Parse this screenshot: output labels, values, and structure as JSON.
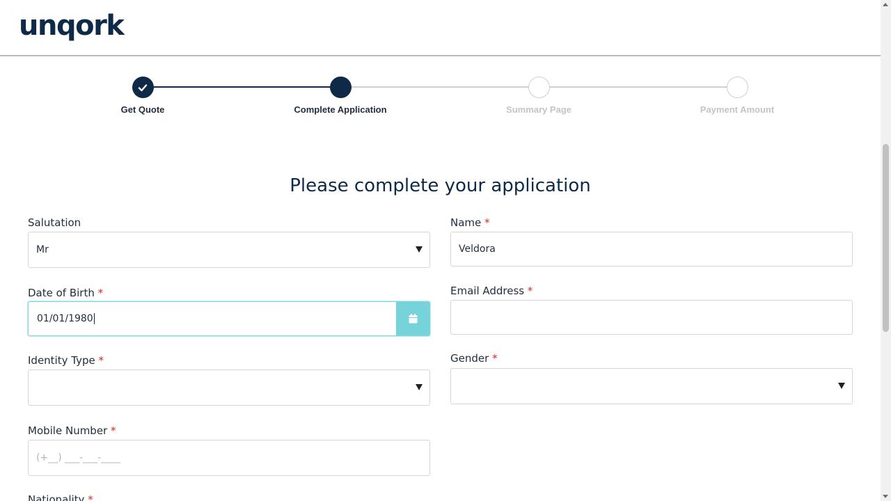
{
  "header": {
    "logo": "unqork"
  },
  "stepper": {
    "steps": [
      {
        "label": "Get Quote",
        "state": "done"
      },
      {
        "label": "Complete Application",
        "state": "active"
      },
      {
        "label": "Summary Page",
        "state": "todo"
      },
      {
        "label": "Payment Amount",
        "state": "todo"
      }
    ]
  },
  "form": {
    "title": "Please complete your application",
    "salutation": {
      "label": "Salutation",
      "value": "Mr"
    },
    "name": {
      "label": "Name",
      "required": "*",
      "value": "Veldora"
    },
    "dob": {
      "label": "Date of Birth",
      "required": "*",
      "value": "01/01/1980"
    },
    "email": {
      "label": "Email Address",
      "required": "*",
      "value": ""
    },
    "identity_type": {
      "label": "Identity Type",
      "required": "*",
      "value": ""
    },
    "gender": {
      "label": "Gender",
      "required": "*",
      "value": ""
    },
    "mobile": {
      "label": "Mobile Number",
      "required": "*",
      "placeholder": "(+__) ___-___-____"
    },
    "nationality": {
      "label": "Nationality",
      "required": "*"
    }
  },
  "colors": {
    "brand": "#0e2a47",
    "accent": "#76d3d9",
    "required": "#e02424"
  }
}
